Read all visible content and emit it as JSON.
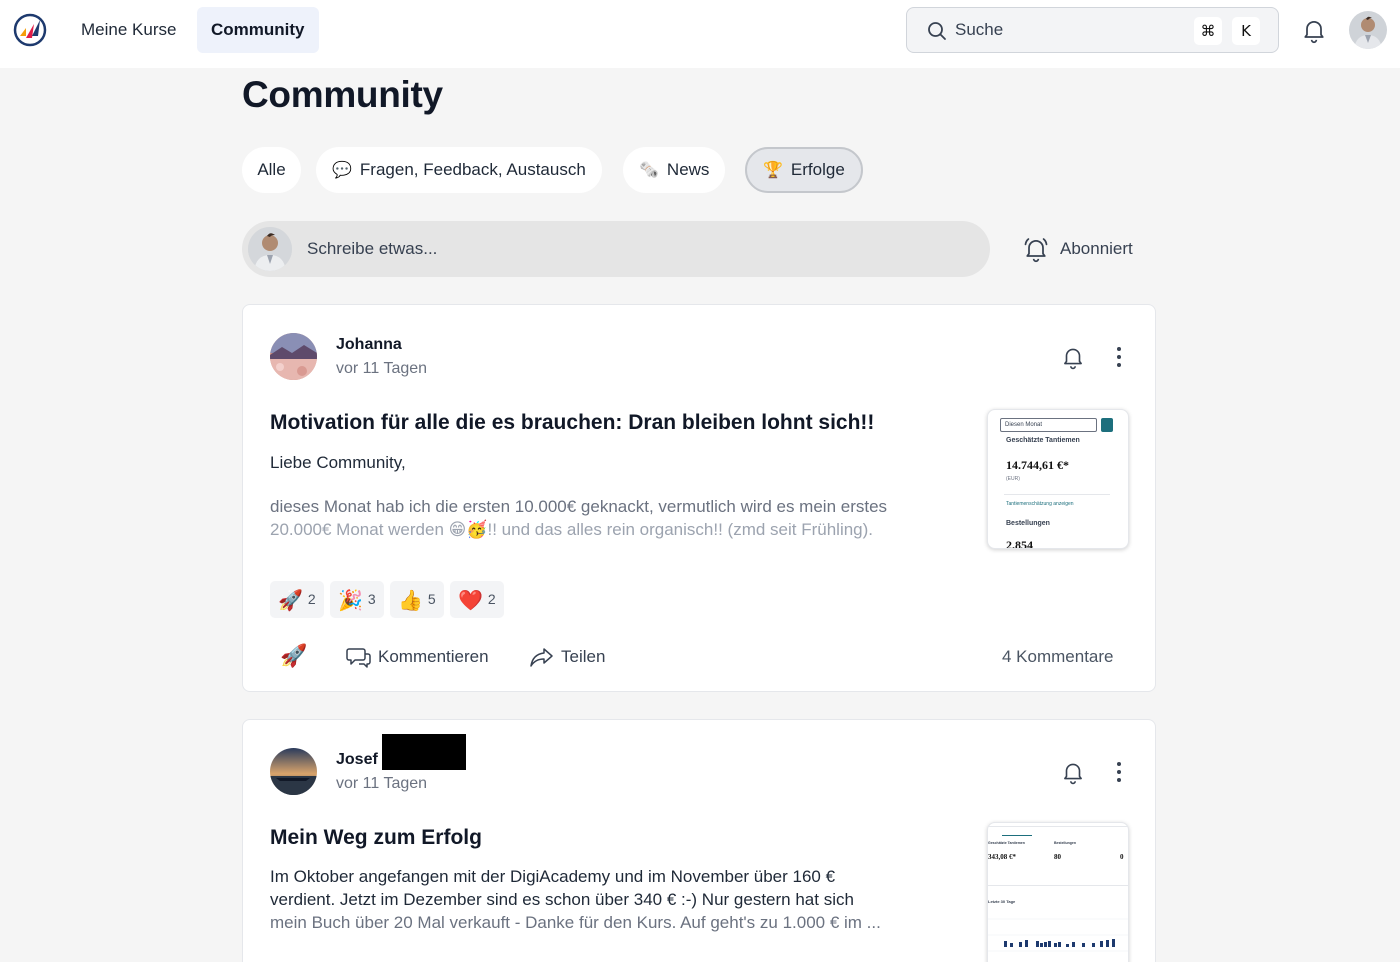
{
  "nav": {
    "courses_label": "Meine Kurse",
    "community_label": "Community"
  },
  "search": {
    "placeholder": "Suche",
    "shortcut_cmd": "⌘",
    "shortcut_key": "K"
  },
  "page": {
    "title": "Community"
  },
  "filters": [
    {
      "label": "Alle",
      "icon": ""
    },
    {
      "label": "Fragen, Feedback, Austausch",
      "icon": "💬"
    },
    {
      "label": "News",
      "icon": "🗞️"
    },
    {
      "label": "Erfolge",
      "icon": "🏆",
      "active": true
    }
  ],
  "composer": {
    "placeholder": "Schreibe etwas...",
    "subscribe_label": "Abonniert"
  },
  "posts": [
    {
      "author": "Johanna",
      "time": "vor 11 Tagen",
      "title": "Motivation für alle die es brauchen: Dran bleiben lohnt sich!!",
      "greeting": "Liebe Community,",
      "body_line1": "dieses Monat hab ich die ersten 10.000€ geknackt, vermutlich wird es mein erstes",
      "body_line2": "20.000€ Monat werden 😁🥳!! und das alles rein organisch!! (zmd seit Frühling).",
      "thumbnail": {
        "select_label": "Diesen Monat",
        "metric_label": "Geschätzte Tantiemen",
        "metric_value": "14.744,61 €*",
        "metric_sub": "(EUR)",
        "link": "Tantiemenschätzung anzeigen",
        "orders_label": "Bestellungen",
        "orders_value": "2.854"
      },
      "reactions": [
        {
          "emoji": "🚀",
          "count": "2"
        },
        {
          "emoji": "🎉",
          "count": "3"
        },
        {
          "emoji": "👍",
          "count": "5"
        },
        {
          "emoji": "❤️",
          "count": "2"
        }
      ],
      "actions": {
        "react_emoji": "🚀",
        "comment_label": "Kommentieren",
        "share_label": "Teilen",
        "comment_count": "4 Kommentare"
      }
    },
    {
      "author": "Josef",
      "time": "vor 11 Tagen",
      "title": "Mein Weg zum Erfolg",
      "body_line1": "Im Oktober angefangen mit der DigiAcademy und im November über 160 €",
      "body_line2": "verdient. Jetzt im Dezember sind es schon über 340 € :-) Nur gestern hat sich",
      "body_line3": "mein Buch über 20 Mal verkauft - Danke für den Kurs. Auf geht's zu 1.000 € im ...",
      "thumbnail": {
        "metric1_label": "Geschätzte Tantiemen",
        "metric1_value": "343,08 €*",
        "metric2_label": "Bestellungen",
        "metric2_value": "80",
        "metric3_value": "0",
        "chart_label": "Letzte 30 Tage"
      }
    }
  ],
  "colors": {
    "background": "#f5f5f5",
    "accent_nav": "#eef2fb",
    "link_teal": "#1d6f7d",
    "chart_bar": "#1e3a6e"
  }
}
